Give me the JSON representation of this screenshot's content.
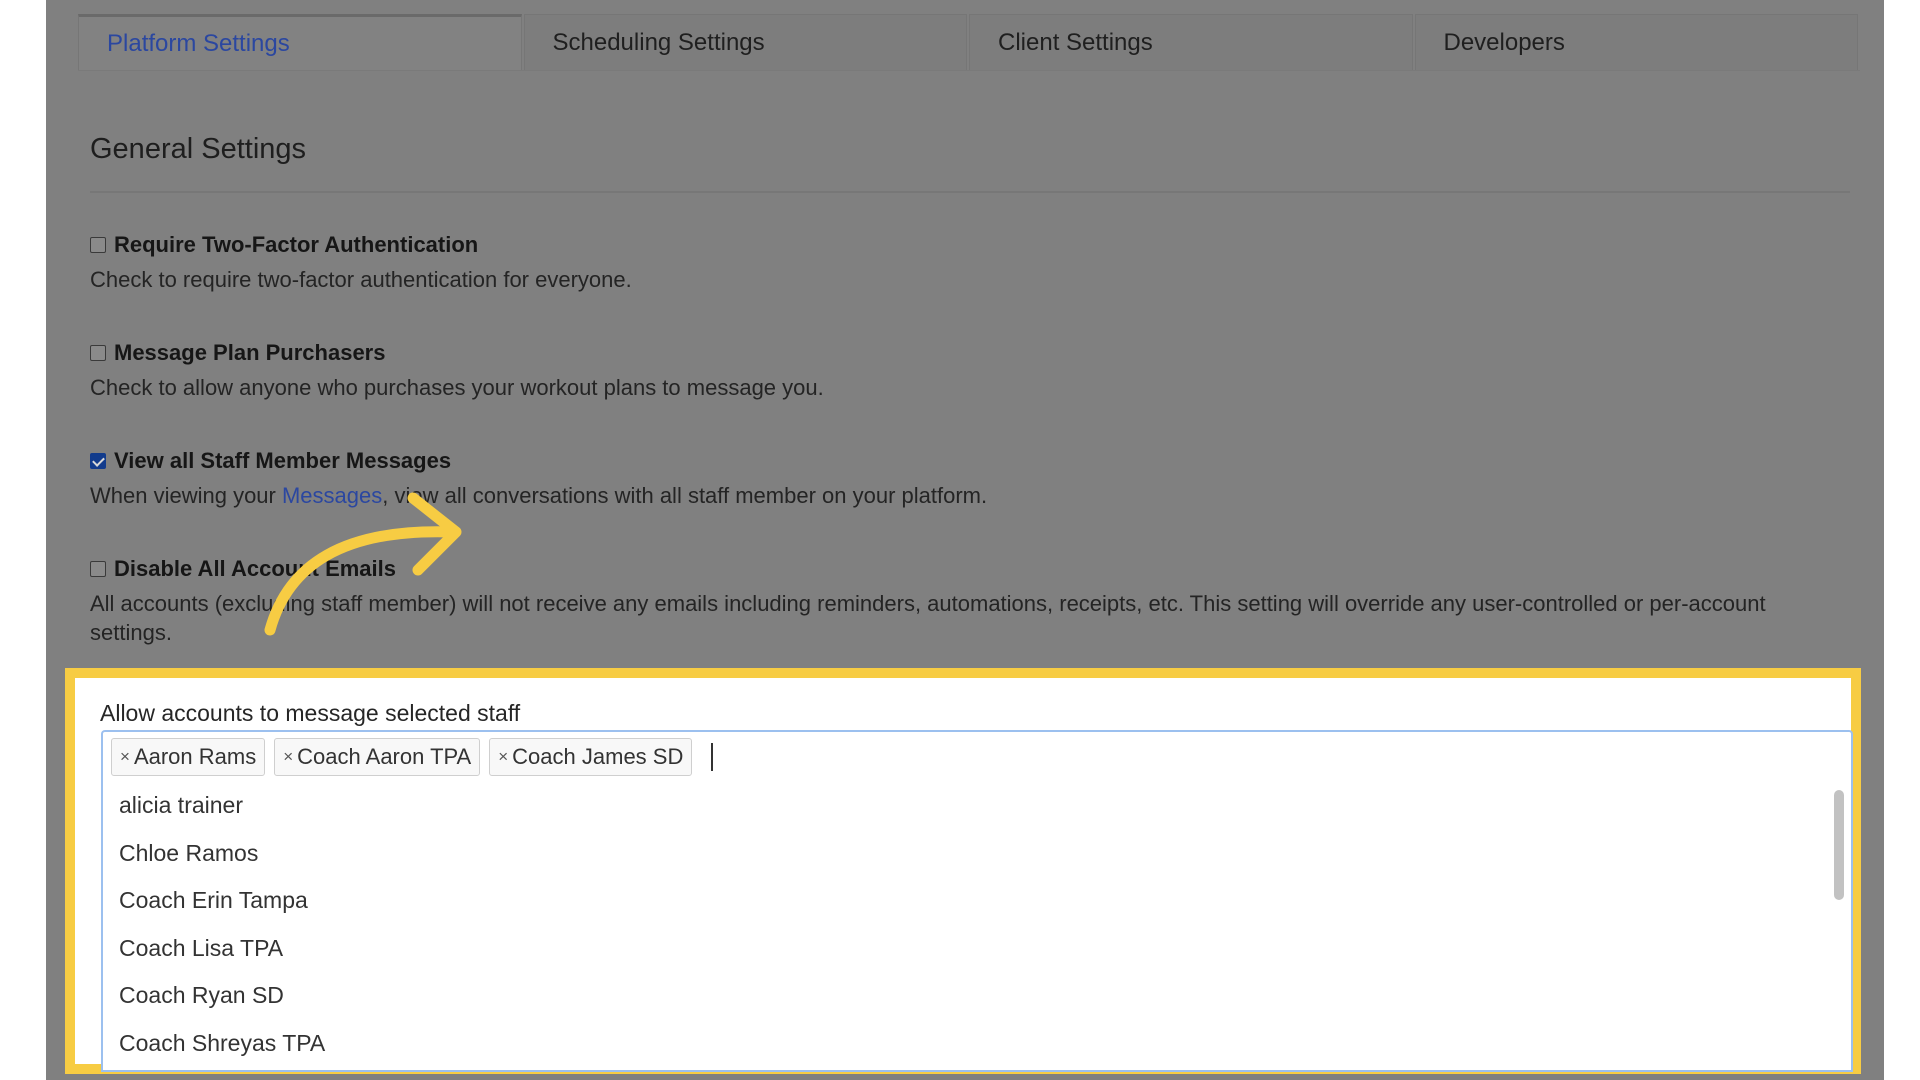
{
  "tabs": [
    {
      "label": "Platform Settings",
      "active": true
    },
    {
      "label": "Scheduling Settings"
    },
    {
      "label": "Client Settings"
    },
    {
      "label": "Developers"
    }
  ],
  "general": {
    "title": "General Settings",
    "settings": [
      {
        "label": "Require Two-Factor Authentication",
        "checked": false,
        "description": "Check to require two-factor authentication for everyone."
      },
      {
        "label": "Message Plan Purchasers",
        "checked": false,
        "description": "Check to allow anyone who purchases your workout plans to message you."
      },
      {
        "label": "View all Staff Member Messages",
        "checked": true,
        "description_prefix": "When viewing your ",
        "description_link": "Messages",
        "description_suffix": ", view all conversations with all staff member on your platform."
      },
      {
        "label": "Disable All Account Emails",
        "checked": false,
        "description": "All accounts (excluding staff member) will not receive any emails including reminders, automations, receipts, etc. This setting will override any user-controlled or per-account settings."
      }
    ]
  },
  "staff_select": {
    "label": "Allow accounts to message selected staff",
    "remove_glyph": "×",
    "selected": [
      "Aaron Rams",
      "Coach Aaron TPA",
      "Coach James SD"
    ],
    "options": [
      "alicia trainer",
      "Chloe Ramos",
      "Coach Erin Tampa",
      "Coach Lisa TPA",
      "Coach Ryan SD",
      "Coach Shreyas TPA"
    ]
  },
  "colors": {
    "highlight": "#f7cc43",
    "arrow": "#f7cc43",
    "link": "#2b47a0",
    "overlay": "#808080"
  }
}
